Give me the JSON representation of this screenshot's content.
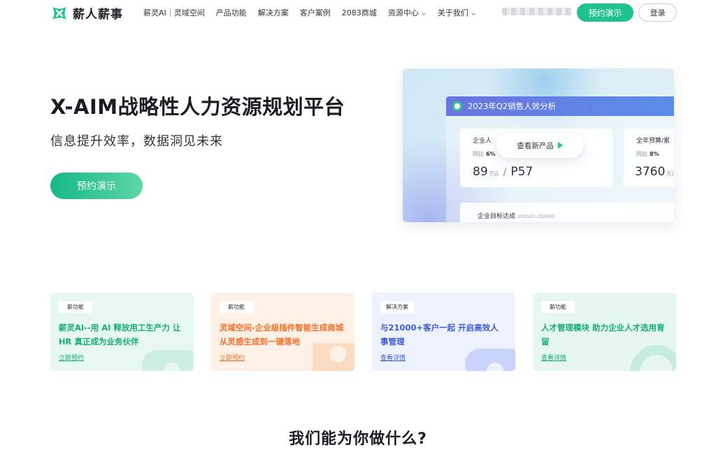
{
  "brand": {
    "name": "薪人薪事",
    "color": "#1ec38f"
  },
  "nav": {
    "items": [
      {
        "label": "薪灵AI｜灵域空间",
        "has_dropdown": false
      },
      {
        "label": "产品功能",
        "has_dropdown": false
      },
      {
        "label": "解决方案",
        "has_dropdown": false
      },
      {
        "label": "客户案例",
        "has_dropdown": false
      },
      {
        "label": "2083商城",
        "has_dropdown": false
      },
      {
        "label": "资源中心",
        "has_dropdown": true
      },
      {
        "label": "关于我们",
        "has_dropdown": true
      }
    ],
    "demo_button": "预约演示",
    "login_button": "登录"
  },
  "hero": {
    "title": "X-AIM战略性人力资源规划平台",
    "subtitle": "信息提升效率，数据洞见未来",
    "cta": "预约演示"
  },
  "dashboard": {
    "title": "2023年Q2销售人效分析",
    "view_button": "查看新产品",
    "card_a": {
      "label": "企业人",
      "yoy_label": "同比",
      "yoy_value": "6%",
      "value": "89",
      "unit": "万元",
      "value2": "P57"
    },
    "card_b": {
      "label": "全年预算/累",
      "yoy_label": "同比",
      "yoy_value": "8%",
      "value": "3760",
      "unit": "万元"
    },
    "card_c": {
      "label": "企业目标达成",
      "date": "2023/01-2023/03"
    }
  },
  "features": [
    {
      "tag": "薪功能",
      "title": "薪灵AI--用 AI 释放用工生产力 让 HR 真正成为业务伙伴",
      "link": "立即预约",
      "accent": "#17ad77"
    },
    {
      "tag": "薪功能",
      "title": "灵域空间-企业级插件智能生成商城 从灵感生成到一键落地",
      "link": "立即预约",
      "accent": "#f2712c"
    },
    {
      "tag": "解决方案",
      "title": "与21000+客户一起 开启高效人事管理",
      "link": "查看详情",
      "accent": "#3e59d8"
    },
    {
      "tag": "薪功能",
      "title": "人才管理模块 助力企业人才选用育留",
      "link": "查看详情",
      "accent": "#17ad77"
    }
  ],
  "section": {
    "title": "我们能为你做什么?"
  }
}
